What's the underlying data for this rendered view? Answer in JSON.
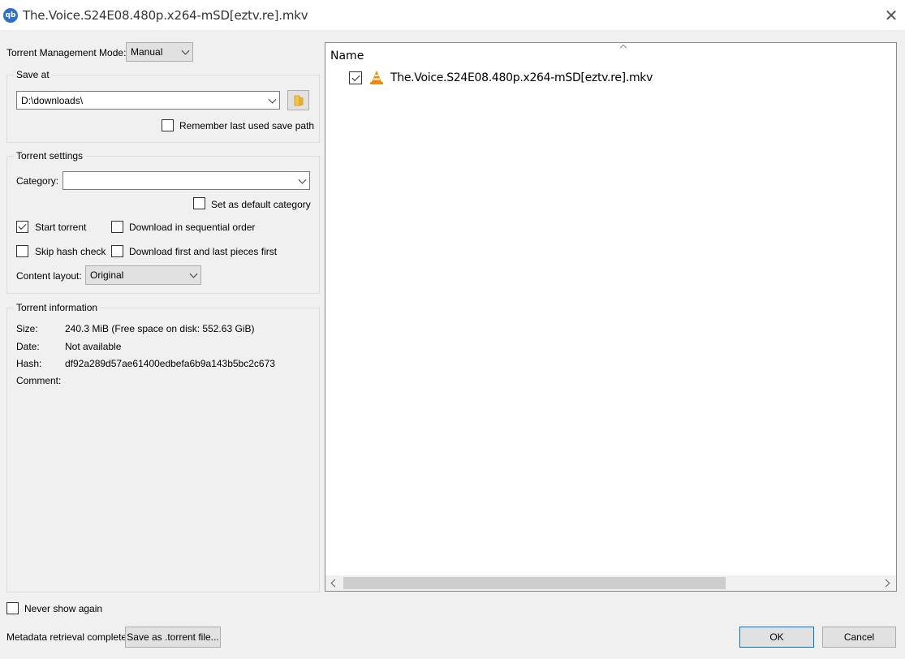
{
  "window": {
    "title": "The.Voice.S24E08.480p.x264-mSD[eztv.re].mkv",
    "app_icon_text": "qb",
    "close_glyph": "✕"
  },
  "management": {
    "label": "Torrent Management Mode:",
    "value": "Manual"
  },
  "save_at": {
    "title": "Save at",
    "path": "D:\\downloads\\",
    "remember_label": "Remember last used save path",
    "remember_checked": false
  },
  "settings": {
    "title": "Torrent settings",
    "category_label": "Category:",
    "category_value": "",
    "default_category_label": "Set as default category",
    "start_torrent_label": "Start torrent",
    "start_torrent_checked": true,
    "sequential_label": "Download in sequential order",
    "skip_hash_label": "Skip hash check",
    "first_last_label": "Download first and last pieces first",
    "content_layout_label": "Content layout:",
    "content_layout_value": "Original"
  },
  "info": {
    "title": "Torrent information",
    "size_label": "Size:",
    "size_value": "240.3 MiB (Free space on disk: 552.63 GiB)",
    "date_label": "Date:",
    "date_value": "Not available",
    "hash_label": "Hash:",
    "hash_value": "df92a289d57ae61400edbefa6b9a143b5bc2c673",
    "comment_label": "Comment:",
    "comment_value": ""
  },
  "files": {
    "column_name": "Name",
    "items": [
      {
        "name": "The.Voice.S24E08.480p.x264-mSD[eztv.re].mkv",
        "checked": true,
        "icon": "vlc-cone-icon"
      }
    ]
  },
  "footer": {
    "never_show_label": "Never show again",
    "status": "Metadata retrieval complete",
    "save_torrent_label": "Save as .torrent file...",
    "ok_label": "OK",
    "cancel_label": "Cancel"
  },
  "colors": {
    "vlc_orange": "#f08a00",
    "app_icon_blue": "#2f6fc6",
    "folder_yellow": "#f5c542"
  }
}
